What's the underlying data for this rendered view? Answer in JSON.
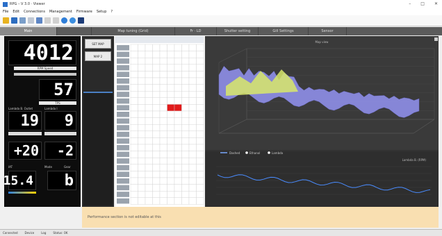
{
  "app": {
    "title": "RPG – V 3.0 · Viewer"
  },
  "menu": [
    "File",
    "Edit",
    "Connections",
    "Management",
    "Firmware",
    "Setup",
    "?"
  ],
  "tabs": [
    "Main",
    "",
    "Map tuning (Grid)",
    "Fr · LD",
    "Shutter setting",
    "Gill Settings",
    "Sensor"
  ],
  "gauges": {
    "rpm": "4012",
    "rpm_label": "RPM Speed",
    "tps": "57",
    "tps_label": "TPS",
    "lambda_left": "19",
    "lambda_right": "9",
    "lambda_left_label": "Lambda B. Outlet",
    "lambda_right_label": "Lambda I",
    "advance": "+20",
    "correction": "-2",
    "temp": "15.4",
    "mode": "b",
    "temp_label": "IAT",
    "mode_label": "Mode",
    "gear_label": "Gear"
  },
  "side_buttons": [
    "SET MAP",
    "MAP 2"
  ],
  "chart_caption": "Map view",
  "lower_chart_caption": "Lambda B. (RPM)",
  "legend": [
    "Dashed",
    "Ethanol",
    "Lambda"
  ],
  "hint": "Performance section is not editable at this",
  "status": [
    "Connected",
    "Device",
    "Log",
    "Status: OK"
  ]
}
